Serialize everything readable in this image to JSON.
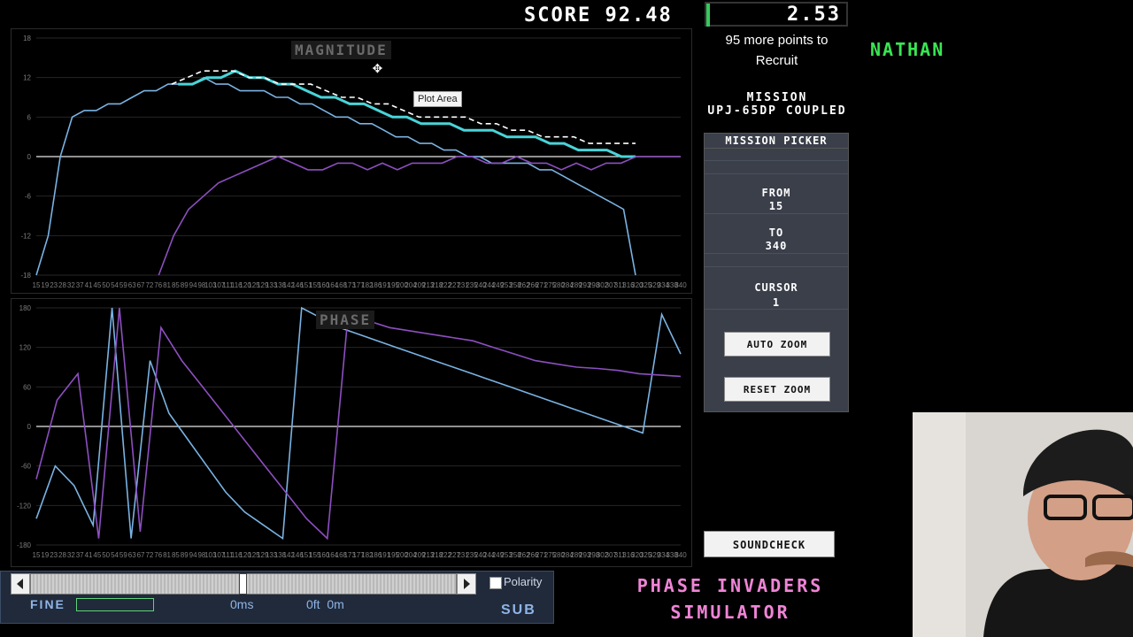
{
  "score": {
    "label": "SCORE",
    "value": "92.48",
    "box_value": "2.53"
  },
  "recruit_text_line1": "95 more points to",
  "recruit_text_line2": "Recruit",
  "player_name": "NATHAN",
  "mission": {
    "title": "MISSION",
    "name": "UPJ-65DP COUPLED"
  },
  "picker": {
    "title": "MISSION PICKER",
    "from_label": "FROM",
    "from_value": "15",
    "to_label": "TO",
    "to_value": "340",
    "cursor_label": "CURSOR",
    "cursor_value": "1",
    "auto_zoom": "AUTO ZOOM",
    "reset_zoom": "RESET ZOOM"
  },
  "soundcheck": "SOUNDCHECK",
  "app_title_line1": "PHASE INVADERS",
  "app_title_line2": "SIMULATOR",
  "tooltip": "Plot Area",
  "controls": {
    "polarity_label": "Polarity",
    "fine_label": "FINE",
    "sub_label": "SUB",
    "delay_ms": "0ms",
    "distance": "0ft  0m"
  },
  "colors": {
    "blue": "#7ab3e3",
    "purple": "#8d4fc0",
    "cyan": "#49d4d8",
    "dash": "#ffffff",
    "green": "#39e652",
    "pink": "#f084d6"
  },
  "chart_data": [
    {
      "type": "line",
      "title": "MAGNITUDE",
      "ylim": [
        -18,
        18
      ],
      "yticks": [
        18,
        12,
        6,
        0,
        -6,
        -12,
        -18
      ],
      "xticks": [
        "15",
        "19",
        "23",
        "28",
        "32",
        "37",
        "41",
        "45",
        "50",
        "54",
        "59",
        "63",
        "67",
        "72",
        "76",
        "81",
        "85",
        "89",
        "94",
        "98",
        "103",
        "107",
        "111",
        "116",
        "120",
        "125",
        "129",
        "133",
        "138",
        "142",
        "146",
        "151",
        "155",
        "160",
        "164",
        "168",
        "173",
        "177",
        "182",
        "186",
        "191",
        "195",
        "200",
        "204",
        "209",
        "213",
        "218",
        "222",
        "227",
        "231",
        "235",
        "240",
        "244",
        "249",
        "253",
        "258",
        "262",
        "266",
        "271",
        "275",
        "280",
        "284",
        "289",
        "293",
        "298",
        "302",
        "307",
        "311",
        "316",
        "320",
        "325",
        "329",
        "334",
        "338",
        "340"
      ],
      "series": [
        {
          "color": "blue",
          "values": [
            -18,
            -12,
            0,
            6,
            7,
            7,
            8,
            8,
            9,
            10,
            10,
            11,
            11,
            11,
            12,
            11,
            11,
            10,
            10,
            10,
            9,
            9,
            8,
            8,
            7,
            6,
            6,
            5,
            5,
            4,
            3,
            3,
            2,
            2,
            1,
            1,
            0,
            0,
            -1,
            -1,
            -1,
            -1,
            -2,
            -2,
            -3,
            -4,
            -5,
            -6,
            -7,
            -8,
            -18
          ]
        },
        {
          "color": "cyan",
          "values": [
            11,
            11,
            12,
            12,
            13,
            12,
            12,
            11,
            11,
            10,
            9,
            9,
            8,
            8,
            7,
            6,
            6,
            5,
            5,
            5,
            4,
            4,
            4,
            3,
            3,
            3,
            2,
            2,
            1,
            1,
            1,
            0,
            0
          ]
        },
        {
          "color": "dash",
          "values": [
            11,
            12,
            13,
            13,
            13,
            12,
            12,
            11,
            11,
            11,
            10,
            9,
            9,
            8,
            8,
            7,
            6,
            6,
            6,
            6,
            5,
            5,
            4,
            4,
            3,
            3,
            3,
            2,
            2,
            2,
            2
          ]
        },
        {
          "color": "purple",
          "values": [
            -18,
            -12,
            -8,
            -6,
            -4,
            -3,
            -2,
            -1,
            0,
            -1,
            -2,
            -2,
            -1,
            -1,
            -2,
            -1,
            -2,
            -1,
            -1,
            -1,
            0,
            0,
            -1,
            -1,
            0,
            -1,
            -1,
            -2,
            -1,
            -2,
            -1,
            -1,
            0,
            0,
            0,
            0
          ]
        }
      ]
    },
    {
      "type": "line",
      "title": "PHASE",
      "ylim": [
        -180,
        180
      ],
      "yticks": [
        180,
        120,
        60,
        0,
        -60,
        -120,
        -180
      ],
      "xticks": [
        "15",
        "19",
        "23",
        "28",
        "32",
        "37",
        "41",
        "45",
        "50",
        "54",
        "59",
        "63",
        "67",
        "72",
        "76",
        "81",
        "85",
        "89",
        "94",
        "98",
        "103",
        "107",
        "111",
        "116",
        "120",
        "125",
        "129",
        "133",
        "138",
        "142",
        "146",
        "151",
        "155",
        "160",
        "164",
        "168",
        "173",
        "177",
        "182",
        "186",
        "191",
        "195",
        "200",
        "204",
        "209",
        "213",
        "218",
        "222",
        "227",
        "231",
        "235",
        "240",
        "244",
        "249",
        "253",
        "258",
        "262",
        "266",
        "271",
        "275",
        "280",
        "284",
        "289",
        "293",
        "298",
        "302",
        "307",
        "311",
        "316",
        "320",
        "325",
        "329",
        "334",
        "338",
        "340"
      ],
      "series": [
        {
          "color": "blue",
          "values": [
            -140,
            -60,
            -90,
            -150,
            180,
            -170,
            100,
            20,
            -20,
            -60,
            -100,
            -130,
            -150,
            -170,
            180,
            165,
            150,
            140,
            130,
            120,
            110,
            100,
            90,
            80,
            70,
            60,
            50,
            40,
            30,
            20,
            10,
            0,
            -10,
            170,
            110
          ]
        },
        {
          "color": "purple",
          "values": [
            -80,
            40,
            80,
            -170,
            180,
            -160,
            150,
            100,
            60,
            20,
            -20,
            -60,
            -100,
            -140,
            -170,
            170,
            160,
            150,
            145,
            140,
            135,
            130,
            120,
            110,
            100,
            95,
            90,
            88,
            85,
            80,
            78,
            76
          ]
        }
      ]
    }
  ]
}
